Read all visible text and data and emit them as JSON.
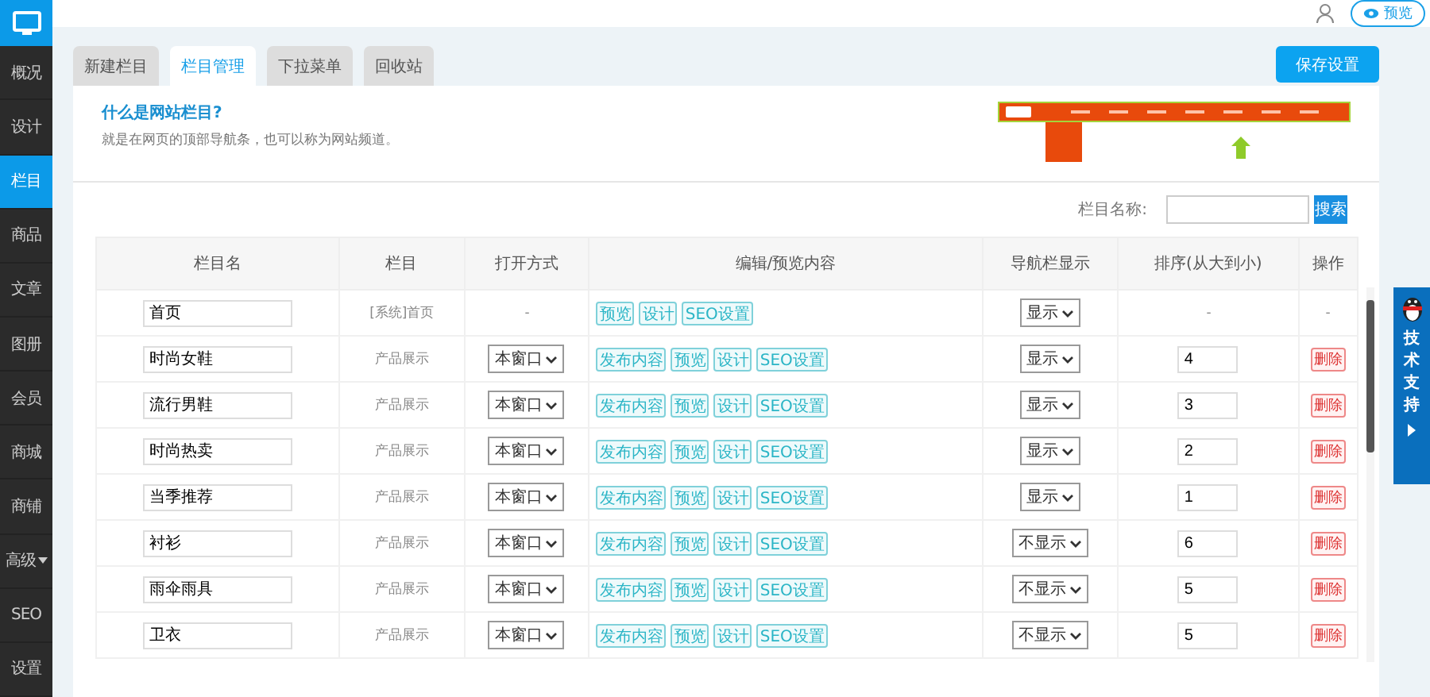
{
  "sidebar": {
    "items": [
      {
        "label": "概况",
        "selected": false,
        "dropdown": false
      },
      {
        "label": "设计",
        "selected": false,
        "dropdown": false
      },
      {
        "label": "栏目",
        "selected": true,
        "dropdown": false
      },
      {
        "label": "商品",
        "selected": false,
        "dropdown": false
      },
      {
        "label": "文章",
        "selected": false,
        "dropdown": false
      },
      {
        "label": "图册",
        "selected": false,
        "dropdown": false
      },
      {
        "label": "会员",
        "selected": false,
        "dropdown": false
      },
      {
        "label": "商城",
        "selected": false,
        "dropdown": false
      },
      {
        "label": "商铺",
        "selected": false,
        "dropdown": false
      },
      {
        "label": "高级",
        "selected": false,
        "dropdown": true
      },
      {
        "label": "SEO",
        "selected": false,
        "dropdown": false
      },
      {
        "label": "设置",
        "selected": false,
        "dropdown": false
      }
    ]
  },
  "top_bar": {
    "preview_button": "预览"
  },
  "tabs": [
    {
      "label": "新建栏目",
      "selected": false
    },
    {
      "label": "栏目管理",
      "selected": true
    },
    {
      "label": "下拉菜单",
      "selected": false
    },
    {
      "label": "回收站",
      "selected": false
    }
  ],
  "save_button": "保存设置",
  "intro": {
    "title": "什么是网站栏目?",
    "text": "就是在网页的顶部导航条，也可以称为网站频道。"
  },
  "search": {
    "label": "栏目名称:",
    "button": "搜索"
  },
  "table": {
    "columns": [
      "栏目名",
      "栏目",
      "打开方式",
      "编辑/预览内容",
      "导航栏显示",
      "排序(从大到小)",
      "操作"
    ],
    "rows": [
      {
        "kind": "system",
        "name": "首页",
        "column": "[系统]首页",
        "open_mode": "-",
        "actions": [
          "预览",
          "设计",
          "SEO设置"
        ],
        "nav": "显示",
        "order": "-",
        "operation": "-"
      },
      {
        "kind": "custom",
        "name": "时尚女鞋",
        "column": "产品展示",
        "open_mode": "本窗口",
        "actions": [
          "发布内容",
          "预览",
          "设计",
          "SEO设置"
        ],
        "nav": "显示",
        "order": "4",
        "operation": "删除"
      },
      {
        "kind": "custom",
        "name": "流行男鞋",
        "column": "产品展示",
        "open_mode": "本窗口",
        "actions": [
          "发布内容",
          "预览",
          "设计",
          "SEO设置"
        ],
        "nav": "显示",
        "order": "3",
        "operation": "删除"
      },
      {
        "kind": "custom",
        "name": "时尚热卖",
        "column": "产品展示",
        "open_mode": "本窗口",
        "actions": [
          "发布内容",
          "预览",
          "设计",
          "SEO设置"
        ],
        "nav": "显示",
        "order": "2",
        "operation": "删除"
      },
      {
        "kind": "custom",
        "name": "当季推荐",
        "column": "产品展示",
        "open_mode": "本窗口",
        "actions": [
          "发布内容",
          "预览",
          "设计",
          "SEO设置"
        ],
        "nav": "显示",
        "order": "1",
        "operation": "删除"
      },
      {
        "kind": "custom",
        "name": "衬衫",
        "column": "产品展示",
        "open_mode": "本窗口",
        "actions": [
          "发布内容",
          "预览",
          "设计",
          "SEO设置"
        ],
        "nav": "不显示",
        "order": "6",
        "operation": "删除"
      },
      {
        "kind": "custom",
        "name": "雨伞雨具",
        "column": "产品展示",
        "open_mode": "本窗口",
        "actions": [
          "发布内容",
          "预览",
          "设计",
          "SEO设置"
        ],
        "nav": "不显示",
        "order": "5",
        "operation": "删除"
      },
      {
        "kind": "custom",
        "name": "卫衣",
        "column": "产品展示",
        "open_mode": "本窗口",
        "actions": [
          "发布内容",
          "预览",
          "设计",
          "SEO设置"
        ],
        "nav": "不显示",
        "order": "5",
        "operation": "删除"
      }
    ]
  },
  "support_tab": {
    "label": "技术支持"
  }
}
